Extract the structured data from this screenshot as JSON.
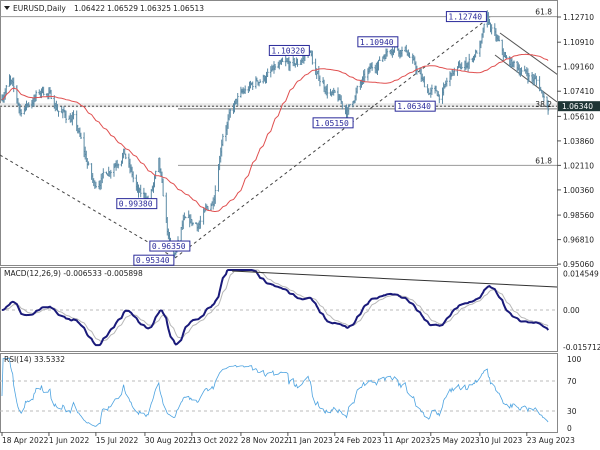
{
  "header": {
    "symbol": "EURUSD,Daily",
    "open": "1.06422",
    "high": "1.06529",
    "low": "1.06325",
    "close": "1.06513"
  },
  "colors": {
    "bars": "#5b8aa5",
    "ma": "#e05050",
    "macd": "#1a1a7a",
    "signal": "#b8b8b8",
    "rsi": "#4da3e0",
    "annotation": "#2a2a9a",
    "price_tag_bg": "#1f3535"
  },
  "chart_data": [
    {
      "type": "ohlc",
      "title": "EURUSD,Daily",
      "x_ticks": [
        "18 Apr 2022",
        "1 Jun 2022",
        "15 Jul 2022",
        "30 Aug 2022",
        "13 Oct 2022",
        "28 Nov 2022",
        "11 Jan 2023",
        "24 Feb 2023",
        "11 Apr 2023",
        "25 May 2023",
        "10 Jul 2023",
        "23 Aug 2023"
      ],
      "y_ticks": [
        "1.12710",
        "1.10910",
        "1.09160",
        "1.07410",
        "1.05610",
        "1.03860",
        "1.02110",
        "1.00360",
        "0.98560",
        "0.96810",
        "0.95060"
      ],
      "ylim": [
        0.9506,
        1.1271
      ],
      "current_price": "1.06340",
      "close_path": [
        [
          "2022-04-16",
          1.068
        ],
        [
          "2022-04-25",
          1.082
        ],
        [
          "2022-05-05",
          1.06
        ],
        [
          "2022-05-21",
          1.071
        ],
        [
          "2022-05-28",
          1.076
        ],
        [
          "2022-06-11",
          1.06
        ],
        [
          "2022-06-25",
          1.053
        ],
        [
          "2022-07-13",
          1.007
        ],
        [
          "2022-07-27",
          1.018
        ],
        [
          "2022-08-10",
          1.032
        ],
        [
          "2022-08-24",
          1.0
        ],
        [
          "2022-09-03",
          0.996
        ],
        [
          "2022-09-12",
          1.021
        ],
        [
          "2022-09-21",
          0.968
        ],
        [
          "2022-09-26",
          0.955
        ],
        [
          "2022-10-05",
          0.979
        ],
        [
          "2022-10-19",
          0.979
        ],
        [
          "2022-11-02",
          0.996
        ],
        [
          "2022-11-11",
          1.046
        ],
        [
          "2022-11-25",
          1.068
        ],
        [
          "2022-12-14",
          1.082
        ],
        [
          "2023-01-02",
          1.09
        ],
        [
          "2023-01-20",
          1.093
        ],
        [
          "2023-01-31",
          1.105
        ],
        [
          "2023-02-06",
          1.086
        ],
        [
          "2023-02-22",
          1.071
        ],
        [
          "2023-03-08",
          1.06
        ],
        [
          "2023-03-17",
          1.075
        ],
        [
          "2023-03-31",
          1.09
        ],
        [
          "2023-04-18",
          1.107
        ],
        [
          "2023-05-02",
          1.104
        ],
        [
          "2023-05-21",
          1.075
        ],
        [
          "2023-06-04",
          1.071
        ],
        [
          "2023-06-13",
          1.086
        ],
        [
          "2023-06-27",
          1.093
        ],
        [
          "2023-07-11",
          1.107
        ],
        [
          "2023-07-16",
          1.125
        ],
        [
          "2023-07-25",
          1.111
        ],
        [
          "2023-08-03",
          1.096
        ],
        [
          "2023-08-17",
          1.09
        ],
        [
          "2023-08-31",
          1.082
        ],
        [
          "2023-09-08",
          1.071
        ],
        [
          "2023-09-12",
          1.065
        ]
      ],
      "moving_average": "red",
      "annotations": [
        {
          "text": "1.12740",
          "date": "2023-07-18",
          "price": 1.1274
        },
        {
          "text": "1.10320",
          "date": "2023-02-02",
          "price": 1.1032
        },
        {
          "text": "1.10940",
          "date": "2023-04-26",
          "price": 1.1094
        },
        {
          "text": "1.06340",
          "date": "2023-05-31",
          "price": 1.0634
        },
        {
          "text": "1.05150",
          "date": "2023-03-15",
          "price": 1.0515
        },
        {
          "text": "0.99380",
          "date": "2022-09-12",
          "price": 0.9938
        },
        {
          "text": "0.96350",
          "date": "2022-10-13",
          "price": 0.9635
        },
        {
          "text": "0.95340",
          "date": "2022-09-28",
          "price": 0.9534
        }
      ],
      "fib_levels": [
        {
          "label": "61.8",
          "price": 1.1274
        },
        {
          "label": "61.8",
          "price": 1.0211
        },
        {
          "label": "38.2",
          "price": 1.0615
        }
      ]
    },
    {
      "type": "line",
      "title": "MACD(12,26,9) -0.006533 -0.005898",
      "y_ticks": [
        "0.014549",
        "0.00",
        "-0.015712"
      ],
      "ylim": [
        -0.015712,
        0.014549
      ]
    },
    {
      "type": "line",
      "title": "RSI(14) 33.5332",
      "y_ticks": [
        "100",
        "70",
        "30",
        "0"
      ],
      "levels": [
        70,
        30
      ],
      "ylim": [
        0,
        100
      ]
    }
  ]
}
